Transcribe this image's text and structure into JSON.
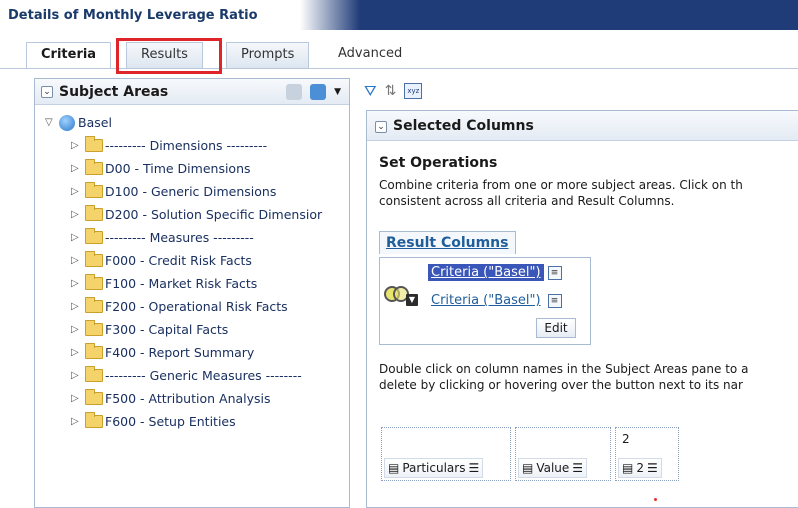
{
  "title": "Details of Monthly Leverage Ratio",
  "tabs": [
    {
      "label": "Criteria",
      "active": true
    },
    {
      "label": "Results",
      "active": false
    },
    {
      "label": "Prompts",
      "active": false
    },
    {
      "label": "Advanced",
      "active": false
    }
  ],
  "subject_areas": {
    "title": "Subject Areas",
    "root": "Basel",
    "items": [
      "--------- Dimensions ---------",
      "D00 - Time Dimensions",
      "D100 - Generic Dimensions",
      "D200 - Solution Specific Dimensior",
      "--------- Measures ---------",
      "F000 - Credit Risk Facts",
      "F100 - Market Risk Facts",
      "F200 - Operational Risk Facts",
      "F300 - Capital Facts",
      "F400 - Report Summary",
      "--------- Generic Measures --------",
      "F500 - Attribution Analysis",
      "F600 - Setup Entities"
    ]
  },
  "selected_columns": {
    "title": "Selected Columns",
    "set_operations_title": "Set Operations",
    "set_operations_desc_1": "Combine criteria from one or more subject areas. Click on th",
    "set_operations_desc_2": "consistent across all criteria and Result Columns.",
    "result_columns_label": "Result Columns",
    "criteria": [
      "Criteria (\"Basel\")",
      "Criteria (\"Basel\")"
    ],
    "edit_label": "Edit",
    "double_click_desc_1": "Double click on column names in the Subject Areas pane to a",
    "double_click_desc_2": "delete by clicking or hovering over the button next to its nar",
    "columns": [
      {
        "value": "",
        "label": "Particulars"
      },
      {
        "value": "",
        "label": "Value"
      },
      {
        "value": "2",
        "label": "2"
      }
    ]
  },
  "colors": {
    "title_bar": "#1f3b78",
    "link": "#1f5e9a",
    "selection": "#3a56b8",
    "highlight": "#e0252a"
  }
}
